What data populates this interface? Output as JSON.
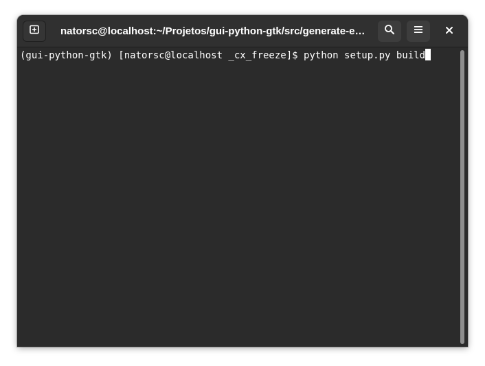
{
  "window": {
    "title": "natorsc@localhost:~/Projetos/gui-python-gtk/src/generate-exec…"
  },
  "headerbar": {
    "new_tab_icon": "tab-new-icon",
    "search_icon": "search-icon",
    "menu_icon": "hamburger-menu-icon",
    "close_icon": "close-icon"
  },
  "terminal": {
    "prompt": "(gui-python-gtk) [natorsc@localhost _cx_freeze]$ ",
    "command": "python setup.py build"
  },
  "colors": {
    "background": "#2b2b2b",
    "headerbar": "#303030",
    "text": "#ffffff"
  }
}
